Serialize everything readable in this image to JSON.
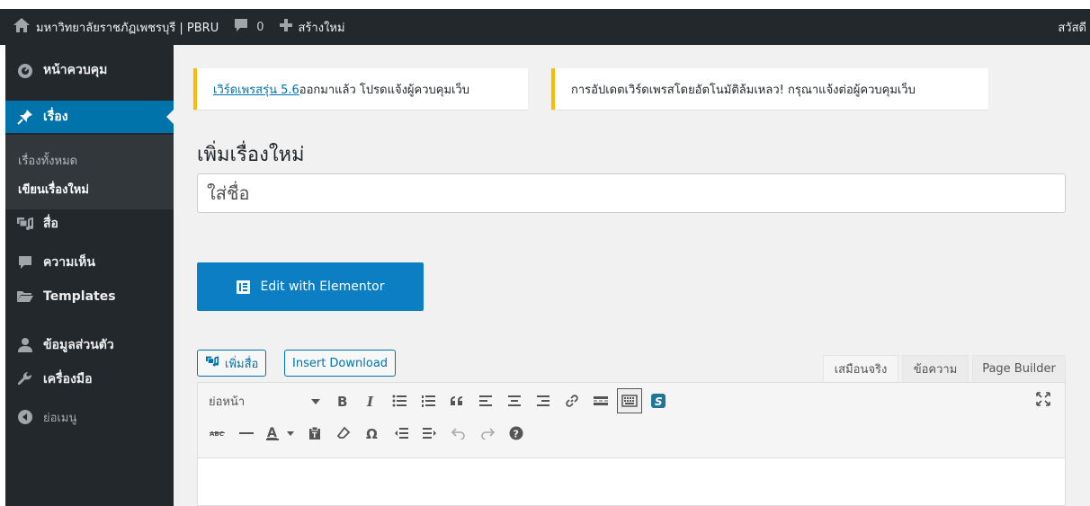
{
  "adminbar": {
    "site_name": "มหาวิทยาลัยราชภัฏเพชรบุรี | PBRU",
    "comments_count": "0",
    "new_label": "สร้างใหม่",
    "greeting": "สวัสดี"
  },
  "sidebar": {
    "dashboard": "หน้าควบคุม",
    "posts": "เรื่อง",
    "all_posts": "เรื่องทั้งหมด",
    "add_new": "เขียนเรื่องใหม่",
    "media": "สื่อ",
    "comments": "ความเห็น",
    "templates": "Templates",
    "profile": "ข้อมูลส่วนตัว",
    "tools": "เครื่องมือ",
    "collapse": "ย่อเมนู"
  },
  "notices": {
    "update_link": "เวิร์ดเพรสรุ่น 5.6",
    "update_text": " ออกมาแล้ว โปรดแจ้งผู้ควบคุมเว็บ",
    "auto_update_fail": "การอัปเดตเวิร์ดเพรสโดยอัตโนมัติล้มเหลว! กรุณาแจ้งต่อผู้ควบคุมเว็บ"
  },
  "editor": {
    "page_title": "เพิ่มเรื่องใหม่",
    "title_placeholder": "ใส่ชื่อ",
    "elementor_button": "Edit with Elementor",
    "add_media": "เพิ่มสื่อ",
    "insert_download": "Insert Download",
    "tabs": [
      "เสมือนจริง",
      "ข้อความ",
      "Page Builder"
    ],
    "format_select": "ย่อหน้า"
  },
  "colors": {
    "admin_dark": "#23282d",
    "accent": "#0073aa",
    "elementor": "#0c7fc4",
    "notice_warning": "#ffb900"
  }
}
